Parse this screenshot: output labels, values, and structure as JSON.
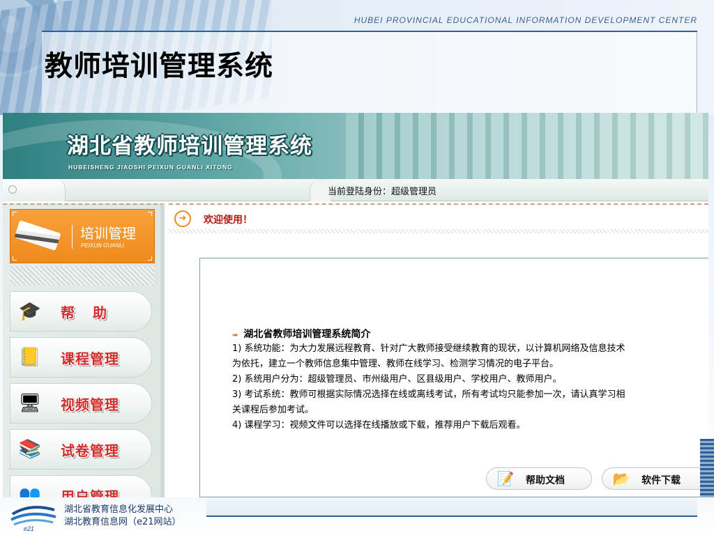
{
  "slide": {
    "header_en": "HUBEI PROVINCIAL EDUCATIONAL INFORMATION DEVELOPMENT CENTER",
    "title": "教师培训管理系统"
  },
  "app": {
    "banner_title": "湖北省教师培训管理系统",
    "banner_subtitle": "HUBEISHENG JIAOSHI PEIXUN GUANLI XITONG",
    "login_status": "当前登陆身份：超级管理员"
  },
  "sidebar": {
    "logo_cn": "培训管理",
    "logo_en": "PEIXUN GUANLI",
    "items": [
      {
        "label": "帮助",
        "icon": "graduate-icon"
      },
      {
        "label": "课程管理",
        "icon": "book-pencil-icon"
      },
      {
        "label": "视频管理",
        "icon": "monitor-icon"
      },
      {
        "label": "试卷管理",
        "icon": "books-stack-icon"
      },
      {
        "label": "用户管理",
        "icon": "users-icon"
      }
    ]
  },
  "main": {
    "welcome": "欢迎使用！",
    "intro_title": "湖北省教师培训管理系统简介",
    "intro_lines": [
      "1) 系统功能：为大力发展远程教育、针对广大教师接受继续教育的现状，以计算机网络及信息技术",
      "为依托，建立一个教师信息集中管理、教师在线学习、检测学习情况的电子平台。",
      "2) 系统用户分为：超级管理员、市州级用户、区县级用户、学校用户、教师用户。",
      "3) 考试系统：教师可根据实际情况选择在线或离线考试，所有考试均只能参加一次，请认真学习相",
      "关课程后参加考试。",
      "4) 课程学习：视频文件可以选择在线播放或下载，推荐用户下载后观看。"
    ],
    "buttons": {
      "help_doc": "帮助文档",
      "software_download": "软件下载"
    }
  },
  "footer": {
    "line1": "湖北省教育信息化发展中心",
    "line2": "湖北教育信息网（e21网站）",
    "logo_text": "e21"
  },
  "colors": {
    "banner_teal": "#2f7f80",
    "menu_label_red": "#d12c2c",
    "logo_orange": "#f08a1c",
    "welcome_red": "#b5180f",
    "header_blue": "#2f5f95"
  }
}
